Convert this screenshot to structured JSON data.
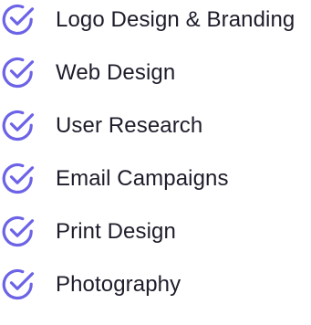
{
  "theme": {
    "accent": "#6c63e6",
    "text": "#1d1d2b"
  },
  "services": {
    "icon": "check-circle-icon",
    "items": [
      {
        "label": "Logo Design & Branding"
      },
      {
        "label": "Web Design"
      },
      {
        "label": "User Research"
      },
      {
        "label": "Email Campaigns"
      },
      {
        "label": "Print Design"
      },
      {
        "label": "Photography"
      }
    ]
  }
}
